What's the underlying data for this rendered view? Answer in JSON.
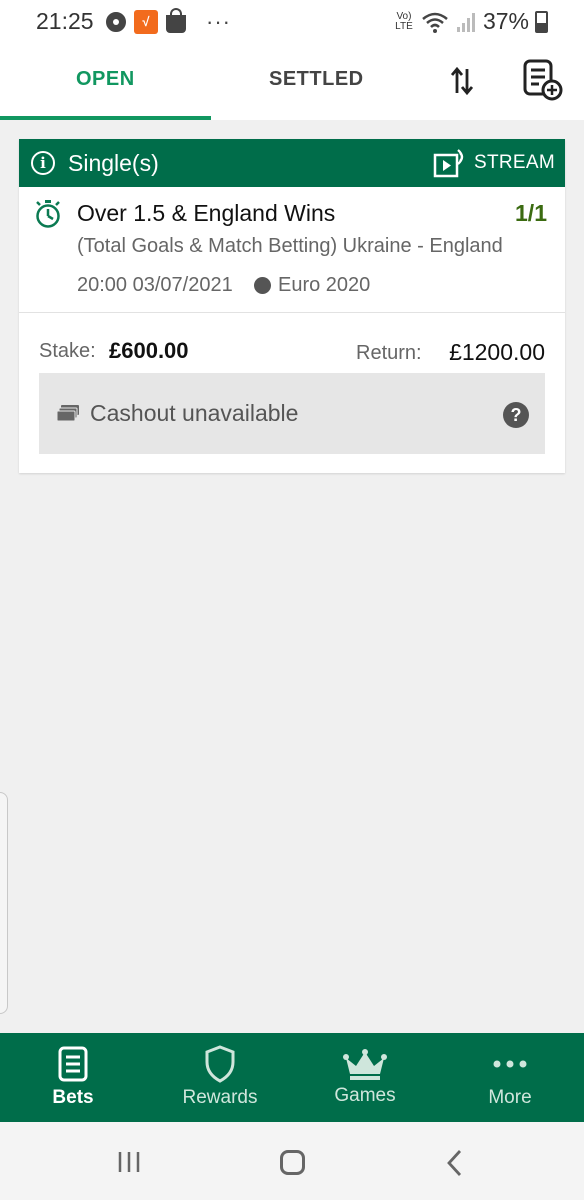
{
  "status_bar": {
    "time": "21:25",
    "network": "Vo) LTE",
    "battery": "37%"
  },
  "tabs": {
    "open": "OPEN",
    "settled": "SETTLED",
    "active": "OPEN"
  },
  "bet": {
    "bet_type": "Single(s)",
    "stream_label": "STREAM",
    "selection": "Over 1.5 & England Wins",
    "odds": "1/1",
    "market": "(Total Goals & Match Betting) Ukraine - England",
    "event_datetime": "20:00 03/07/2021",
    "competition": "Euro 2020",
    "stake_label": "Stake:",
    "stake_value": "£600.00",
    "return_label": "Return:",
    "return_value": "£1200.00",
    "cashout_label": "Cashout unavailable"
  },
  "bottom_nav": {
    "items": [
      {
        "label": "Bets",
        "icon": "bets-icon",
        "active": true
      },
      {
        "label": "Rewards",
        "icon": "shield-icon",
        "active": false
      },
      {
        "label": "Games",
        "icon": "crown-icon",
        "active": false
      },
      {
        "label": "More",
        "icon": "more-dots-icon",
        "active": false
      }
    ]
  },
  "colors": {
    "brand_green": "#006d4a",
    "tab_accent": "#119760",
    "odds_green": "#3b6b11"
  }
}
